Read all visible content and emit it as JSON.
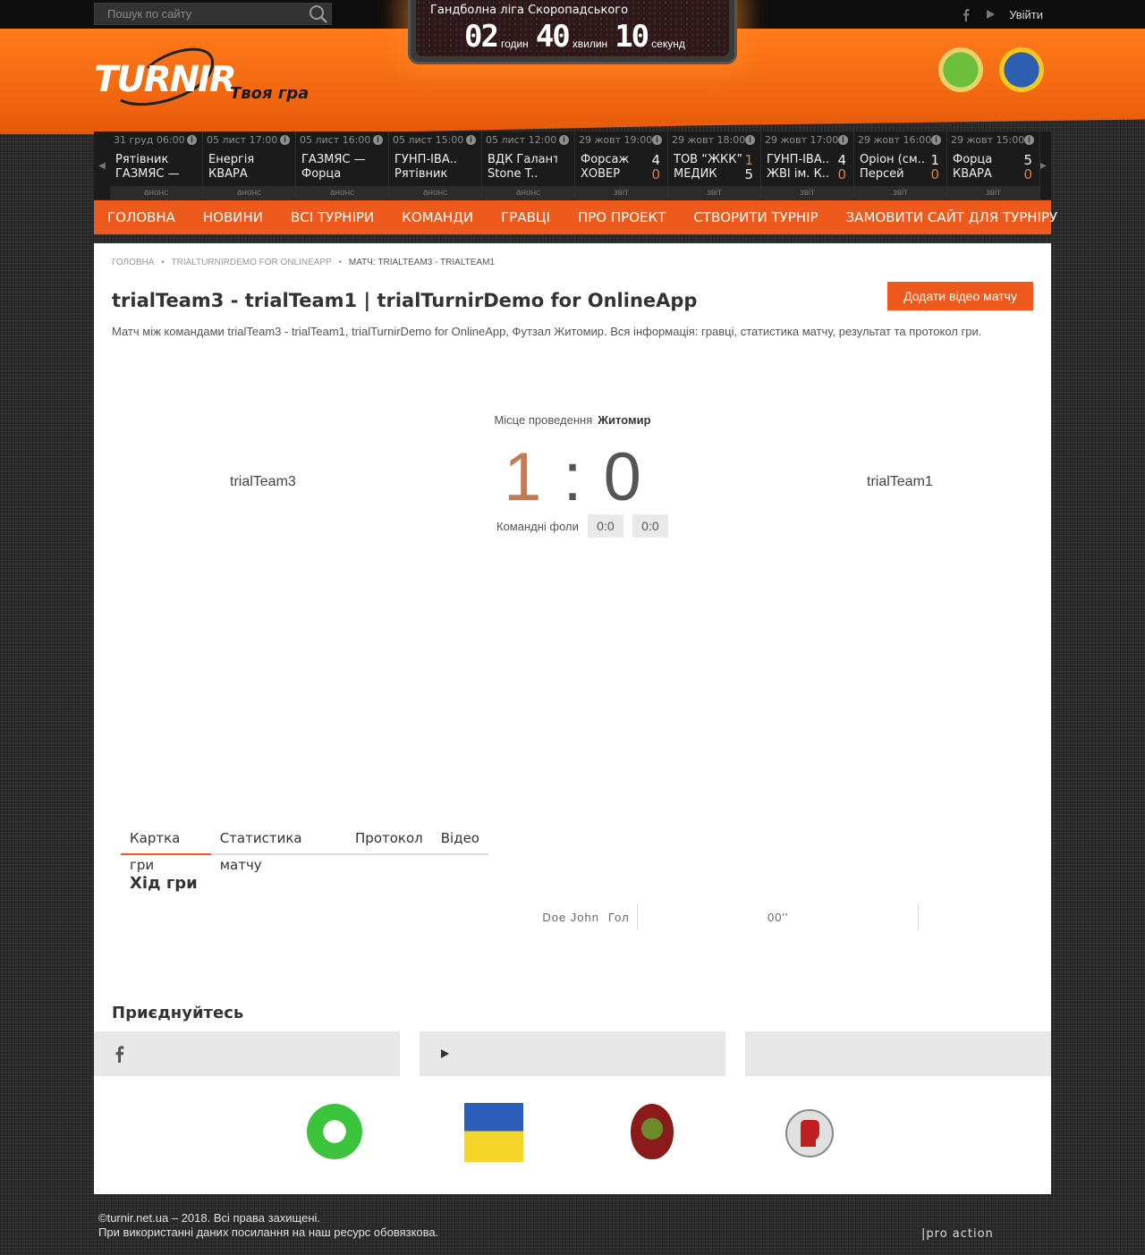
{
  "search": {
    "placeholder": "Пошук по сайту"
  },
  "top": {
    "login_label": "Увійти"
  },
  "logo": {
    "brand": "TURNIR",
    "slogan": "Твоя гра"
  },
  "scoreboard": {
    "title": "Гандболна ліга Скоропадського",
    "hours": "02",
    "hours_label": "годин",
    "minutes": "40",
    "minutes_label": "хвилин",
    "seconds": "10",
    "seconds_label": "секунд"
  },
  "matches": [
    {
      "date": "31 груд 06:00",
      "home": "Рятівник",
      "away": "ГАЗМЯС —",
      "home_score": "",
      "away_score": "",
      "footer": "анонс"
    },
    {
      "date": "05 лист 17:00",
      "home": "Енергія",
      "away": "КВАРА",
      "home_score": "",
      "away_score": "",
      "footer": "анонс"
    },
    {
      "date": "05 лист 16:00",
      "home": "ГАЗМЯС —",
      "away": "Форца",
      "home_score": "",
      "away_score": "",
      "footer": "анонс"
    },
    {
      "date": "05 лист 15:00",
      "home": "ГУНП-ІВА..",
      "away": "Рятівник",
      "home_score": "",
      "away_score": "",
      "footer": "анонс"
    },
    {
      "date": "05 лист 12:00",
      "home": "ВДК Галант",
      "away": "Stone T..",
      "home_score": "",
      "away_score": "",
      "footer": "анонс"
    },
    {
      "date": "29 жовт 19:00",
      "home": "Форсаж",
      "away": "ХОВЕР",
      "home_score": "4",
      "away_score": "0",
      "footer": "звіт"
    },
    {
      "date": "29 жовт 18:00",
      "home": "ТОВ “ЖКК”",
      "away": "МЕДИК",
      "home_score": "1",
      "away_score": "5",
      "footer": "звіт"
    },
    {
      "date": "29 жовт 17:00",
      "home": "ГУНП-ІВА..",
      "away": "ЖВІ ім. К..",
      "home_score": "4",
      "away_score": "0",
      "footer": "звіт"
    },
    {
      "date": "29 жовт 16:00",
      "home": "Оріон (см..",
      "away": "Персей",
      "home_score": "1",
      "away_score": "0",
      "footer": "звіт"
    },
    {
      "date": "29 жовт 15:00",
      "home": "Форца",
      "away": "КВАРА",
      "home_score": "5",
      "away_score": "0",
      "footer": "звіт"
    }
  ],
  "nav": [
    "Головна",
    "Новини",
    "Всі турніри",
    "Команди",
    "Гравці",
    "Про проект",
    "Створити турнір",
    "Замовити сайт для турніру"
  ],
  "breadcrumb": {
    "home": "Головна",
    "tournament": "trialTurnirDemo for OnlineApp",
    "current": "Матч: trialTeam3 - trialTeam1"
  },
  "page": {
    "title": "trialTeam3 - trialTeam1 | trialTurnirDemo for OnlineApp",
    "add_video": "Додати відео матчу",
    "description": "Матч між командами trialTeam3 - trialTeam1, trialTurnirDemo for OnlineApp, Футзал Житомир. Вся інформація: гравці, статистика матчу, результат та протокол гри."
  },
  "match": {
    "venue_label": "Місце проведення",
    "venue": "Житомир",
    "home_team": "trialTeam3",
    "away_team": "trialTeam1",
    "home_score": "1",
    "separator": ":",
    "away_score": "0",
    "fouls_label": "Командні фоли",
    "home_fouls": "0:0",
    "away_fouls": "0:0"
  },
  "tabs": [
    "Картка гри",
    "Статистика матчу",
    "Протокол",
    "Відео"
  ],
  "timeline": {
    "title": "Хід гри",
    "events": [
      {
        "player": "Doe John",
        "type": "Гол",
        "time": "00''"
      }
    ]
  },
  "join": {
    "title": "Приєднуйтесь"
  },
  "footer": {
    "line1": "©turnir.net.ua – 2018. Всі права захищені.",
    "line2": "При використанні даних посилання на наш ресурс обовязкова.",
    "dev": "|pro action"
  },
  "colors": {
    "accent": "#ee5a1c",
    "score_home": "#c57a54"
  }
}
